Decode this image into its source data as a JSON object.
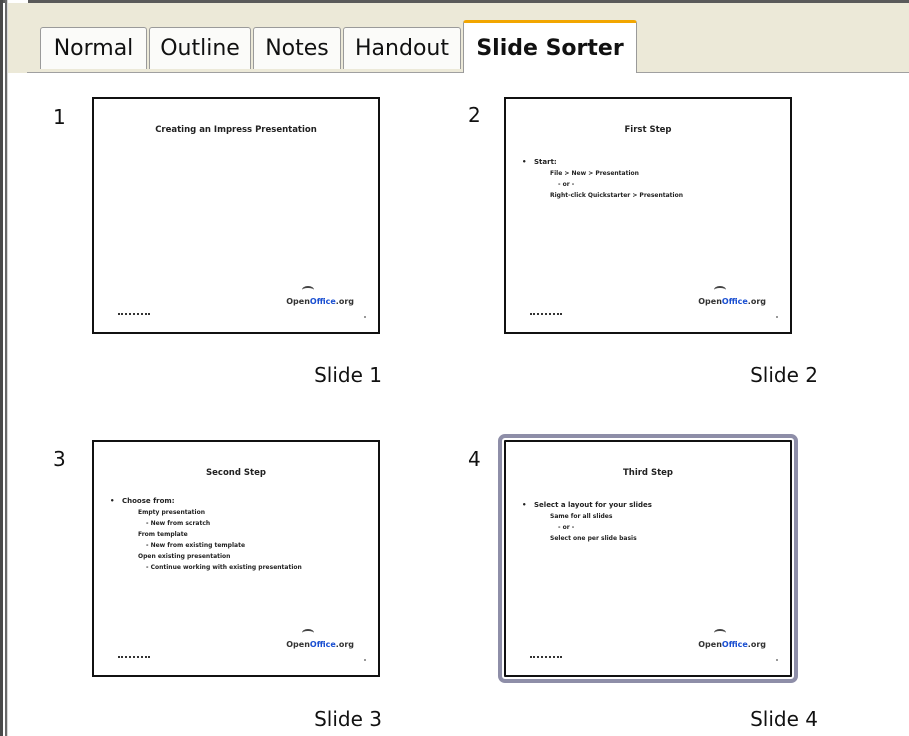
{
  "tabs": [
    {
      "label": "Normal"
    },
    {
      "label": "Outline"
    },
    {
      "label": "Notes"
    },
    {
      "label": "Handout"
    },
    {
      "label": "Slide Sorter",
      "active": true
    }
  ],
  "slides": [
    {
      "number": "1",
      "caption": "Slide 1",
      "title": "Creating an Impress Presentation",
      "lines": [],
      "logo": {
        "text": "Open",
        "brand": "Office",
        "suffix": ".org"
      }
    },
    {
      "number": "2",
      "caption": "Slide 2",
      "title": "First Step",
      "lines": [
        {
          "level": 0,
          "text": "Start:"
        },
        {
          "level": 1,
          "text": "File > New > Presentation"
        },
        {
          "level": 2,
          "text": "- or -"
        },
        {
          "level": 1,
          "text": "Right-click Quickstarter > Presentation"
        }
      ],
      "logo": {
        "text": "Open",
        "brand": "Office",
        "suffix": ".org"
      }
    },
    {
      "number": "3",
      "caption": "Slide 3",
      "title": "Second Step",
      "lines": [
        {
          "level": 0,
          "text": "Choose from:"
        },
        {
          "level": 1,
          "text": "Empty presentation"
        },
        {
          "level": 2,
          "text": "- New from scratch"
        },
        {
          "level": 1,
          "text": "From template"
        },
        {
          "level": 2,
          "text": "- New from existing template"
        },
        {
          "level": 1,
          "text": "Open existing presentation"
        },
        {
          "level": 2,
          "text": "- Continue working with existing presentation"
        }
      ],
      "logo": {
        "text": "Open",
        "brand": "Office",
        "suffix": ".org"
      }
    },
    {
      "number": "4",
      "caption": "Slide 4",
      "title": "Third Step",
      "lines": [
        {
          "level": 0,
          "text": "Select a layout for your slides"
        },
        {
          "level": 1,
          "text": "Same for all slides"
        },
        {
          "level": 2,
          "text": "- or -"
        },
        {
          "level": 1,
          "text": "Select one per slide basis"
        }
      ],
      "selected": true,
      "logo": {
        "text": "Open",
        "brand": "Office",
        "suffix": ".org"
      }
    }
  ],
  "colors": {
    "active_tab_accent": "#f2a600",
    "selection_outline": "#8e8ea8",
    "logo_blue": "#1a4fd1"
  }
}
